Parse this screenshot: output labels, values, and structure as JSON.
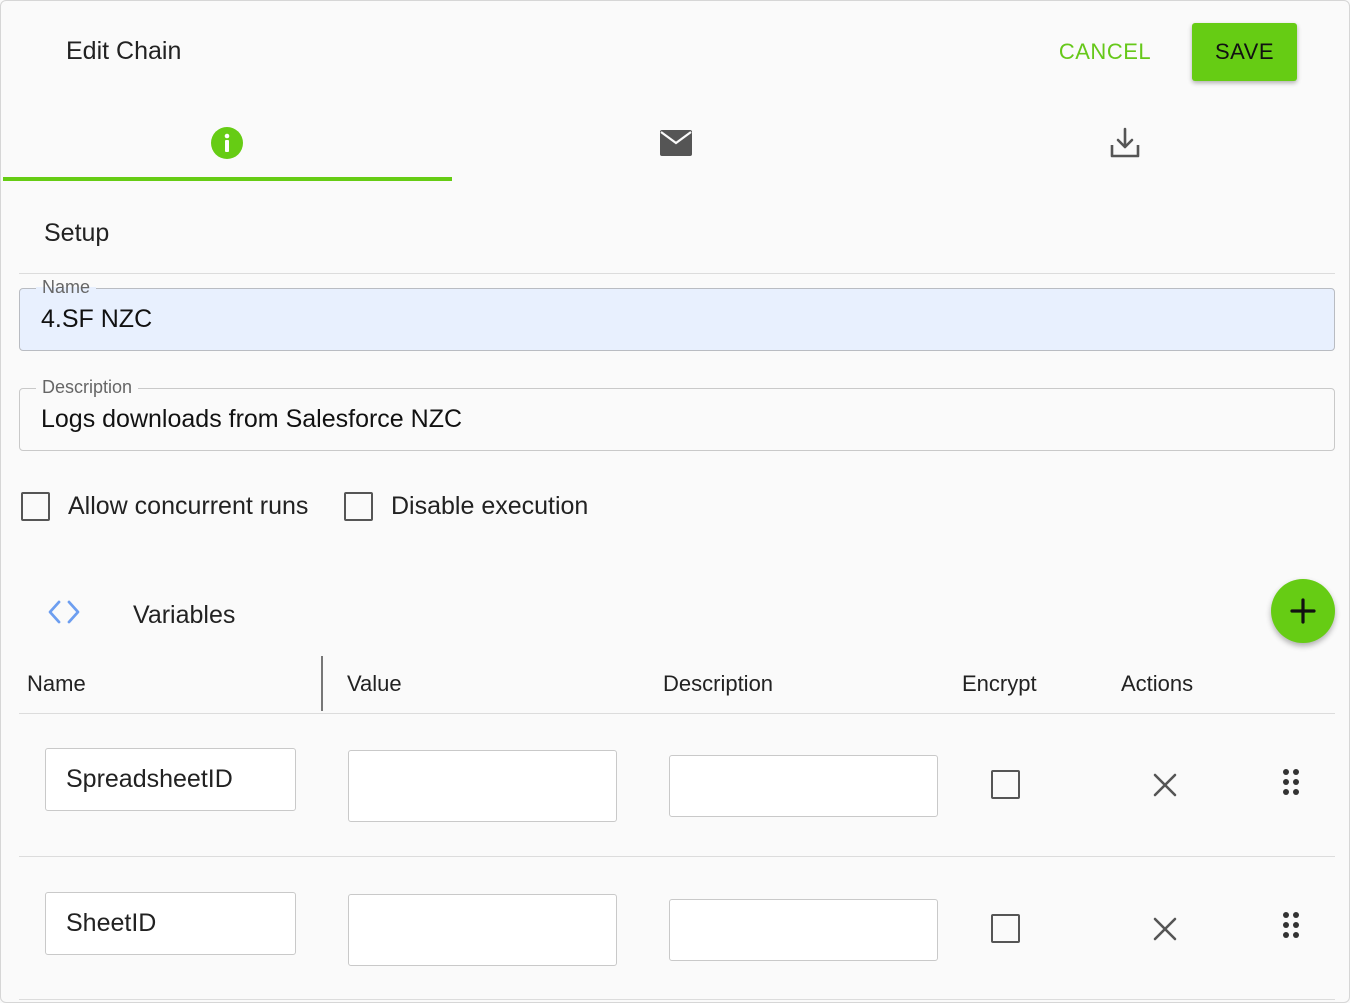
{
  "dialog": {
    "title": "Edit Chain",
    "cancel_label": "CANCEL",
    "save_label": "SAVE",
    "accent_color": "#66cc14"
  },
  "tabs": [
    {
      "icon": "info-icon",
      "active": true
    },
    {
      "icon": "mail-icon",
      "active": false
    },
    {
      "icon": "download-icon",
      "active": false
    }
  ],
  "setup": {
    "section_title": "Setup",
    "name_label": "Name",
    "name_value": "4.SF NZC",
    "description_label": "Description",
    "description_value": "Logs downloads from Salesforce NZC",
    "allow_concurrent_label": "Allow concurrent runs",
    "allow_concurrent_checked": false,
    "disable_execution_label": "Disable execution",
    "disable_execution_checked": false
  },
  "variables": {
    "title": "Variables",
    "icon": "code-brackets-icon",
    "add_icon": "plus-icon",
    "columns": [
      "Name",
      "Value",
      "Description",
      "Encrypt",
      "Actions"
    ],
    "rows": [
      {
        "name": "SpreadsheetID",
        "value": "",
        "description": "",
        "encrypt": false
      },
      {
        "name": "SheetID",
        "value": "",
        "description": "",
        "encrypt": false
      }
    ]
  }
}
